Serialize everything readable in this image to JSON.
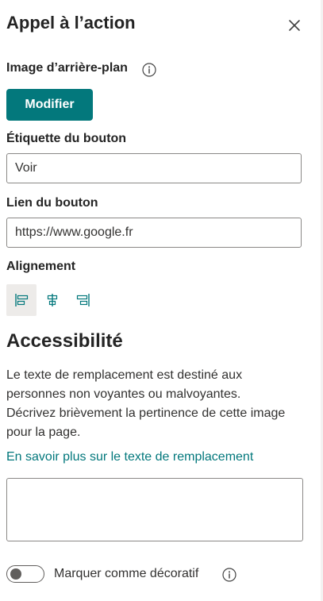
{
  "panel": {
    "title": "Appel à l’action",
    "close_icon": "close-icon"
  },
  "background_image": {
    "label": "Image d’arrière-plan",
    "info_icon": "info-icon",
    "button_label": "Modifier"
  },
  "button_text": {
    "label": "Étiquette du bouton",
    "value": "Voir"
  },
  "button_link": {
    "label": "Lien du bouton",
    "value": "https://www.google.fr"
  },
  "alignment": {
    "label": "Alignement",
    "options": [
      {
        "icon": "align-left-icon",
        "selected": true
      },
      {
        "icon": "align-center-icon",
        "selected": false
      },
      {
        "icon": "align-right-icon",
        "selected": false
      }
    ]
  },
  "accessibility": {
    "title": "Accessibilité",
    "description": "Le texte de remplacement est destiné aux personnes non voyantes ou malvoyantes. Décrivez brièvement la pertinence de cette image pour la page.",
    "link_text": "En savoir plus sur le texte de remplacement",
    "alt_text_value": "",
    "decorative_label": "Marquer comme décoratif",
    "decorative_checked": false,
    "info_icon": "info-icon"
  },
  "colors": {
    "accent": "#03787c",
    "text": "#242424",
    "border": "#8a8886"
  }
}
